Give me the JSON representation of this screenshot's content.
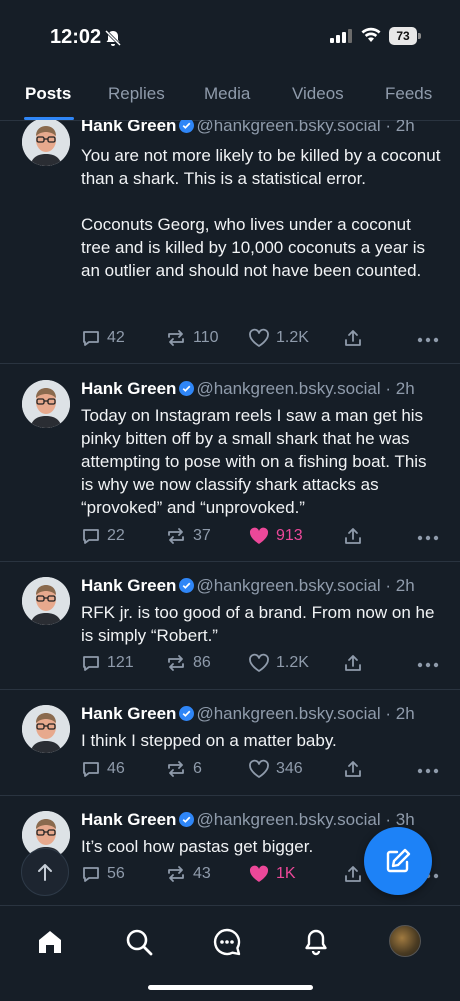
{
  "status_bar": {
    "time": "12:02",
    "battery": "73"
  },
  "tabs": [
    "Posts",
    "Replies",
    "Media",
    "Videos",
    "Feeds"
  ],
  "posts": [
    {
      "author": "Hank Green",
      "handle": "@hankgreen.bsky.social",
      "time": "2h",
      "text": "You are not more likely to be killed by a coconut than a shark. This is a statistical error.\n\nCoconuts Georg, who lives under a coconut tree and is killed by 10,000 coconuts a year is an outlier and should not have been counted.",
      "replies": "42",
      "reposts": "110",
      "likes": "1.2K",
      "liked": false
    },
    {
      "author": "Hank Green",
      "handle": "@hankgreen.bsky.social",
      "time": "2h",
      "text": "Today on Instagram reels I saw a man get his pinky bitten off by a small shark that he was attempting to pose with on a fishing boat. This is why we now classify shark attacks as “provoked” and “unprovoked.”",
      "replies": "22",
      "reposts": "37",
      "likes": "913",
      "liked": true
    },
    {
      "author": "Hank Green",
      "handle": "@hankgreen.bsky.social",
      "time": "2h",
      "text": "RFK jr. is too good of a brand. From now on he is simply “Robert.”",
      "replies": "121",
      "reposts": "86",
      "likes": "1.2K",
      "liked": false
    },
    {
      "author": "Hank Green",
      "handle": "@hankgreen.bsky.social",
      "time": "2h",
      "text": "I think I stepped on a matter baby.",
      "replies": "46",
      "reposts": "6",
      "likes": "346",
      "liked": false
    },
    {
      "author": "Hank Green",
      "handle": "@hankgreen.bsky.social",
      "time": "3h",
      "text": "It’s cool how pastas get bigger.",
      "replies": "56",
      "reposts": "43",
      "likes": "1K",
      "liked": true
    }
  ],
  "colors": {
    "background": "#161e27",
    "accent": "#1d82f7",
    "like": "#ec4899",
    "muted": "#8f9bab"
  },
  "nav_icons": [
    "home-icon",
    "search-icon",
    "chat-icon",
    "bell-icon",
    "profile-avatar"
  ]
}
